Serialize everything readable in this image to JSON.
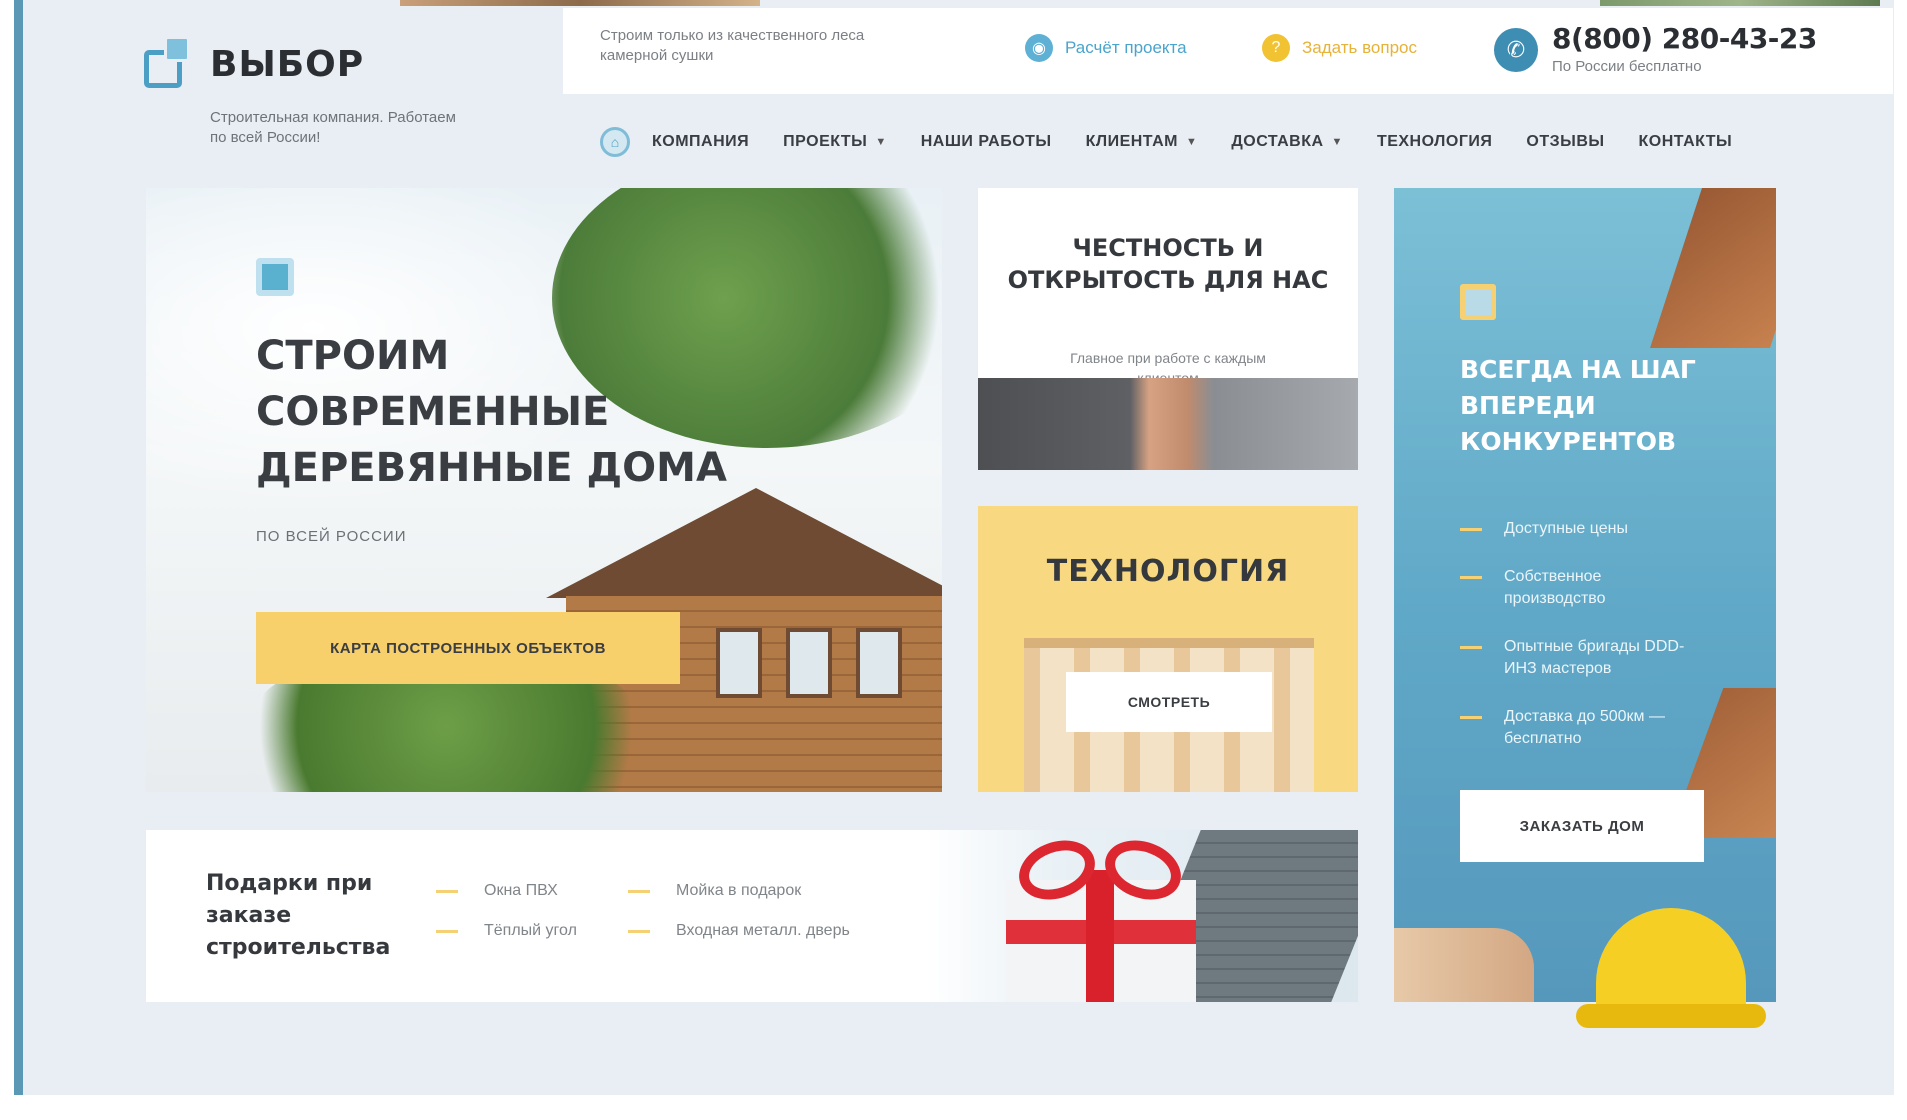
{
  "header": {
    "logo_name": "ВЫБОР",
    "logo_subtitle": "Строительная компания. Работаем по всей России!",
    "note": "Строим только из качественного леса камерной сушки",
    "calc_link": "Расчёт проекта",
    "ask_link": "Задать вопрос",
    "phone": "8(800) 280-43-23",
    "phone_note": "По России бесплатно"
  },
  "nav": {
    "items": [
      {
        "label": "КОМПАНИЯ",
        "dropdown": false
      },
      {
        "label": "ПРОЕКТЫ",
        "dropdown": true
      },
      {
        "label": "НАШИ РАБОТЫ",
        "dropdown": false
      },
      {
        "label": "КЛИЕНТАМ",
        "dropdown": true
      },
      {
        "label": "ДОСТАВКА",
        "dropdown": true
      },
      {
        "label": "ТЕХНОЛОГИЯ",
        "dropdown": false
      },
      {
        "label": "ОТЗЫВЫ",
        "dropdown": false
      },
      {
        "label": "КОНТАКТЫ",
        "dropdown": false
      }
    ]
  },
  "hero": {
    "title": "СТРОИМ СОВРЕМЕННЫЕ ДЕРЕВЯННЫЕ ДОМА",
    "subtitle": "ПО ВСЕЙ РОССИИ",
    "button": "КАРТА ПОСТРОЕННЫХ ОБЪЕКТОВ"
  },
  "honesty": {
    "title": "ЧЕСТНОСТЬ И ОТКРЫТОСТЬ ДЛЯ НАС",
    "text": "Главное при работе с каждым клиентом"
  },
  "technology": {
    "title": "ТЕХНОЛОГИЯ",
    "button": "СМОТРЕТЬ"
  },
  "promo": {
    "title": "ВСЕГДА НА ШАГ ВПЕРЕДИ КОНКУРЕНТОВ",
    "items": [
      "Доступные цены",
      "Собственное производство",
      "Опытные бригады DDD-ИНЗ мастеров",
      "Доставка до 500км — бесплатно"
    ],
    "button": "ЗАКАЗАТЬ ДОМ"
  },
  "gifts": {
    "title": "Подарки при заказе строительства",
    "items": [
      "Окна ПВХ",
      "Мойка в подарок",
      "Тёплый угол",
      "Входная металл. дверь"
    ]
  },
  "colors": {
    "accent_blue": "#4b9fc4",
    "accent_yellow": "#f7d06b",
    "background": "#e8eef3"
  }
}
